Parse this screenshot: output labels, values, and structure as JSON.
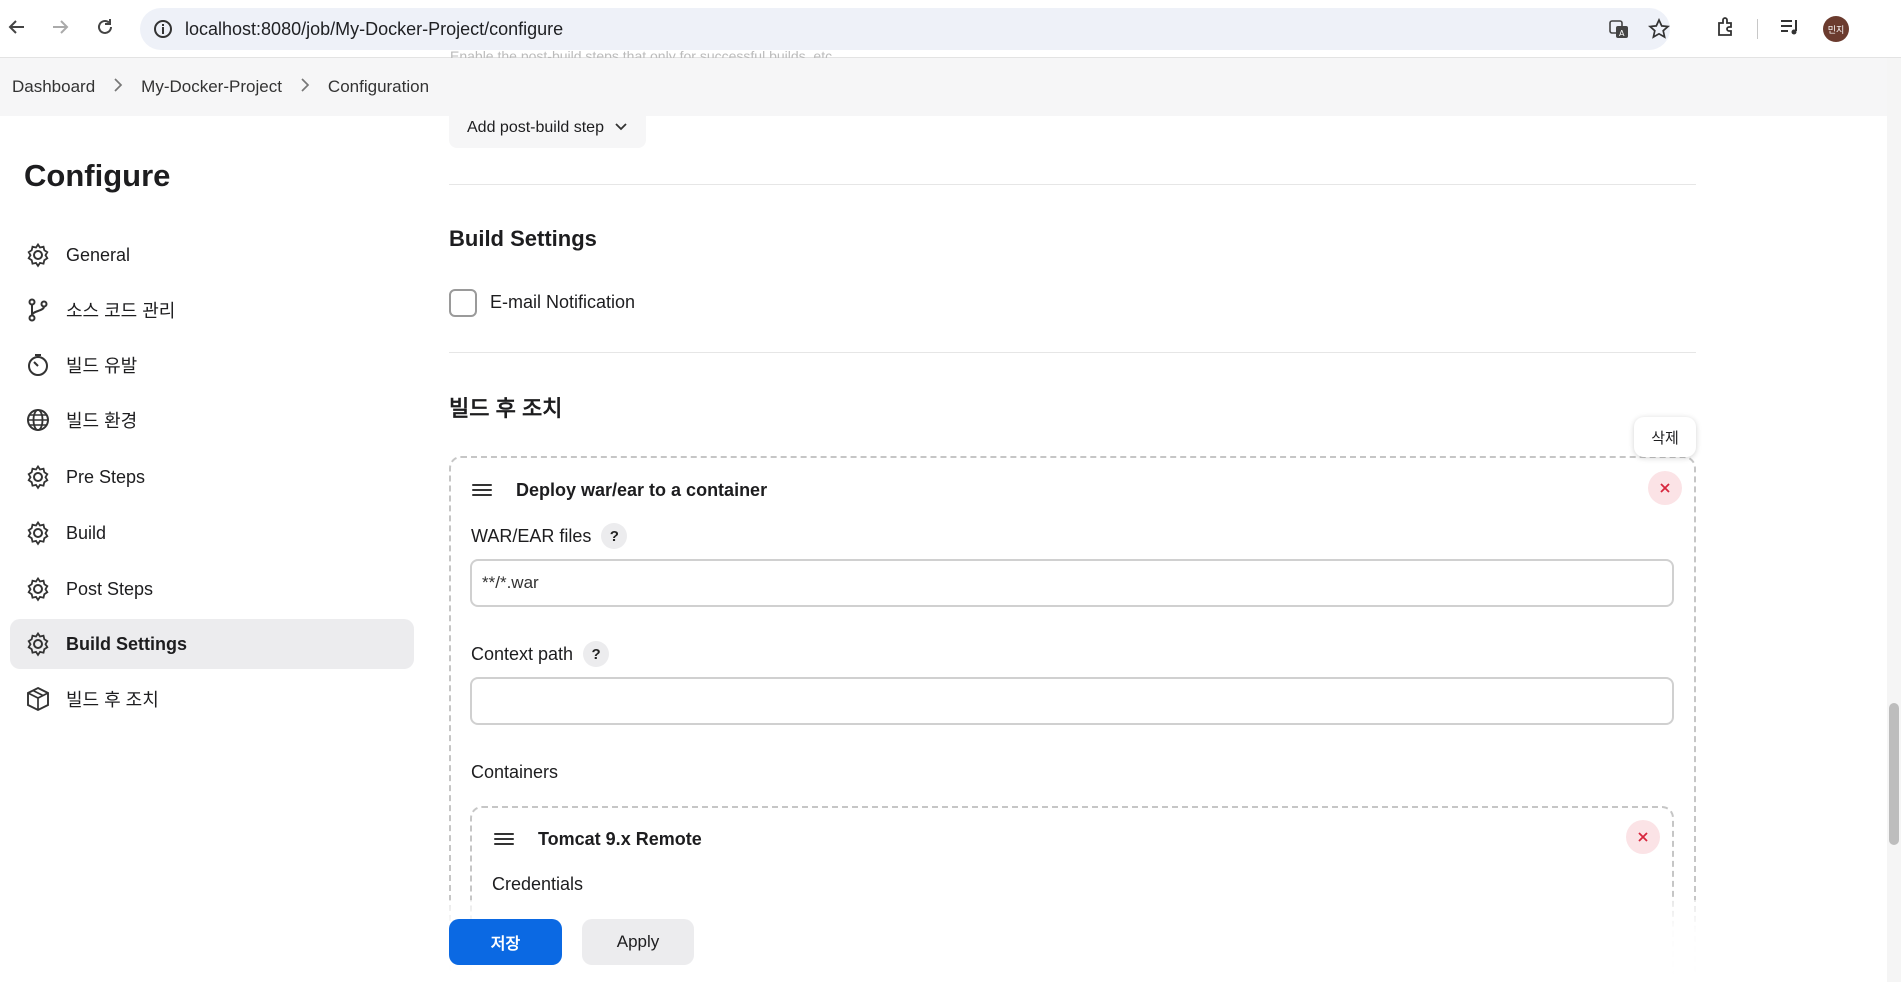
{
  "browser": {
    "url": "localhost:8080/job/My-Docker-Project/configure",
    "avatar_text": "민지"
  },
  "breadcrumb": [
    "Dashboard",
    "My-Docker-Project",
    "Configuration"
  ],
  "faded_text": "Enable the post-build steps that only for successful builds, etc.",
  "sidebar": {
    "title": "Configure",
    "items": [
      {
        "label": "General",
        "icon": "gear-icon"
      },
      {
        "label": "소스 코드 관리",
        "icon": "branch-icon"
      },
      {
        "label": "빌드 유발",
        "icon": "timer-icon"
      },
      {
        "label": "빌드 환경",
        "icon": "globe-icon"
      },
      {
        "label": "Pre Steps",
        "icon": "gear-icon"
      },
      {
        "label": "Build",
        "icon": "gear-icon"
      },
      {
        "label": "Post Steps",
        "icon": "gear-icon"
      },
      {
        "label": "Build Settings",
        "icon": "gear-icon",
        "active": true
      },
      {
        "label": "빌드 후 조치",
        "icon": "package-icon"
      }
    ]
  },
  "main": {
    "add_post_build_step": "Add post-build step",
    "build_settings_heading": "Build Settings",
    "email_notification_label": "E-mail Notification",
    "post_build_heading": "빌드 후 조치",
    "delete_tooltip": "삭제",
    "deploy": {
      "title": "Deploy war/ear to a container",
      "war_label": "WAR/EAR files",
      "war_value": "**/*.war",
      "context_label": "Context path",
      "context_value": "",
      "containers_label": "Containers",
      "help_glyph": "?",
      "container": {
        "title": "Tomcat 9.x Remote",
        "credentials_label": "Credentials"
      }
    }
  },
  "actions": {
    "save_label": "저장",
    "apply_label": "Apply"
  },
  "colors": {
    "primary": "#0b69e3",
    "danger": "#d7263d",
    "active_bg": "#ececee"
  }
}
